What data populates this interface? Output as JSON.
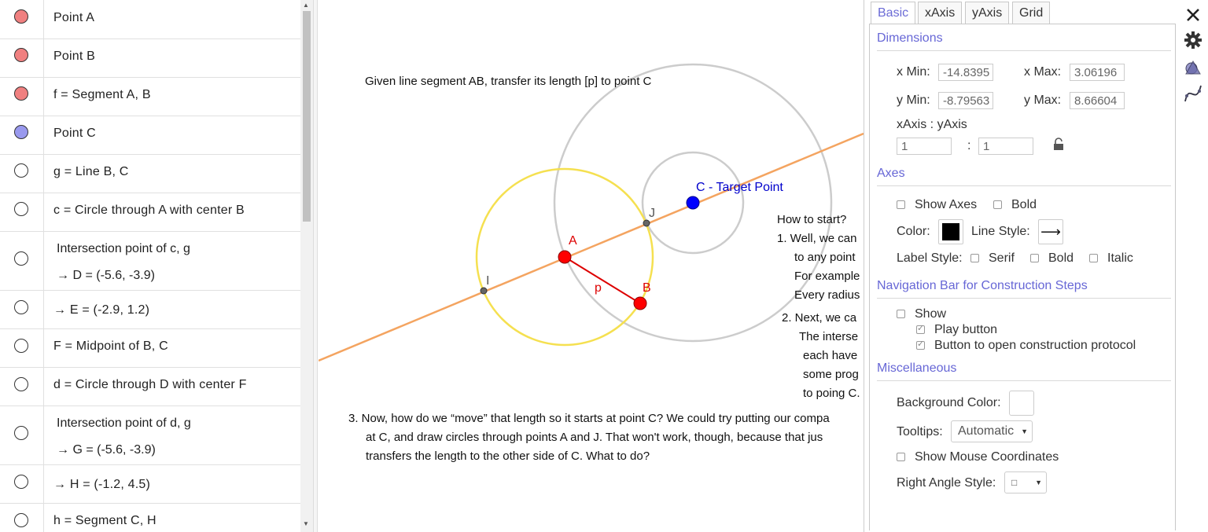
{
  "algebra": {
    "rows": [
      {
        "text": "Point A",
        "color": "#f08080",
        "filled": true
      },
      {
        "text": "Point B",
        "color": "#f08080",
        "filled": true
      },
      {
        "text": "f = Segment A, B",
        "color": "#f08080",
        "filled": true
      },
      {
        "text": "Point C",
        "color": "#9999ee",
        "filled": true
      },
      {
        "text": "g = Line B, C",
        "filled": false
      },
      {
        "text": "c = Circle through A with center B",
        "filled": false
      },
      {
        "text": "Intersection point of c, g",
        "sub": "→  D = (-5.6, -3.9)",
        "filled": false
      },
      {
        "text": "→  E = (-2.9, 1.2)",
        "filled": false
      },
      {
        "text": "F = Midpoint of B, C",
        "filled": false
      },
      {
        "text": "d = Circle through D with center F",
        "filled": false
      },
      {
        "text": "Intersection point of d, g",
        "sub": "→  G = (-5.6, -3.9)",
        "filled": false
      },
      {
        "text": "→  H = (-1.2, 4.5)",
        "filled": false
      },
      {
        "text": "h = Segment C, H",
        "filled": false
      }
    ]
  },
  "graphics": {
    "title": "Given line segment AB, transfer its length [p] to point C",
    "labels": {
      "A": "A",
      "B": "B",
      "p": "p",
      "I": "I",
      "J": "J",
      "C": "C - Target Point"
    },
    "how_to": [
      "How to start?",
      "1. Well, we can",
      "to any point",
      "For example",
      "Every radius",
      "2.  Next, we ca",
      "The interse",
      "each have",
      "some prog",
      "to poing C."
    ],
    "step3": [
      "3.  Now, how do we “move” that length so it starts at point C? We could try putting our compa",
      "at C, and draw circles through points A and J.   That won't work, though, because that jus",
      "transfers the length to the other side of C.  What to do?"
    ],
    "colors": {
      "line": "#f4a460",
      "yellow": "#f5e050",
      "grey_circle": "#cccccc",
      "red": "#ff0000",
      "blue": "#0000ff",
      "label_blue": "#0000cc"
    }
  },
  "settings": {
    "tabs": [
      "Basic",
      "xAxis",
      "yAxis",
      "Grid"
    ],
    "active_tab": "Basic",
    "dimensions": {
      "title": "Dimensions",
      "xmin_label": "x Min:",
      "xmin": "-14.8395",
      "xmax_label": "x Max:",
      "xmax": "3.06196",
      "ymin_label": "y Min:",
      "ymin": "-8.79563",
      "ymax_label": "y Max:",
      "ymax": "8.66604",
      "ratio_label": "xAxis : yAxis",
      "ratio_x": "1",
      "ratio_sep": ":",
      "ratio_y": "1"
    },
    "axes": {
      "title": "Axes",
      "show_axes": "Show Axes",
      "bold": "Bold",
      "color_label": "Color:",
      "color": "#000000",
      "line_style_label": "Line Style:",
      "line_style_glyph": "⟶",
      "label_style_label": "Label Style:",
      "serif": "Serif",
      "bold2": "Bold",
      "italic": "Italic"
    },
    "navbar": {
      "title": "Navigation Bar for Construction Steps",
      "show": "Show",
      "play": "Play button",
      "protocol": "Button to open construction protocol"
    },
    "misc": {
      "title": "Miscellaneous",
      "bg_label": "Background Color:",
      "tooltips_label": "Tooltips:",
      "tooltips_value": "Automatic",
      "mouse_coords": "Show Mouse Coordinates",
      "right_angle_label": "Right Angle Style:",
      "right_angle_value": "□"
    }
  },
  "toolbar_icons": [
    "close-icon",
    "gear-icon",
    "graphics-view-icon",
    "graph-curve-icon"
  ]
}
